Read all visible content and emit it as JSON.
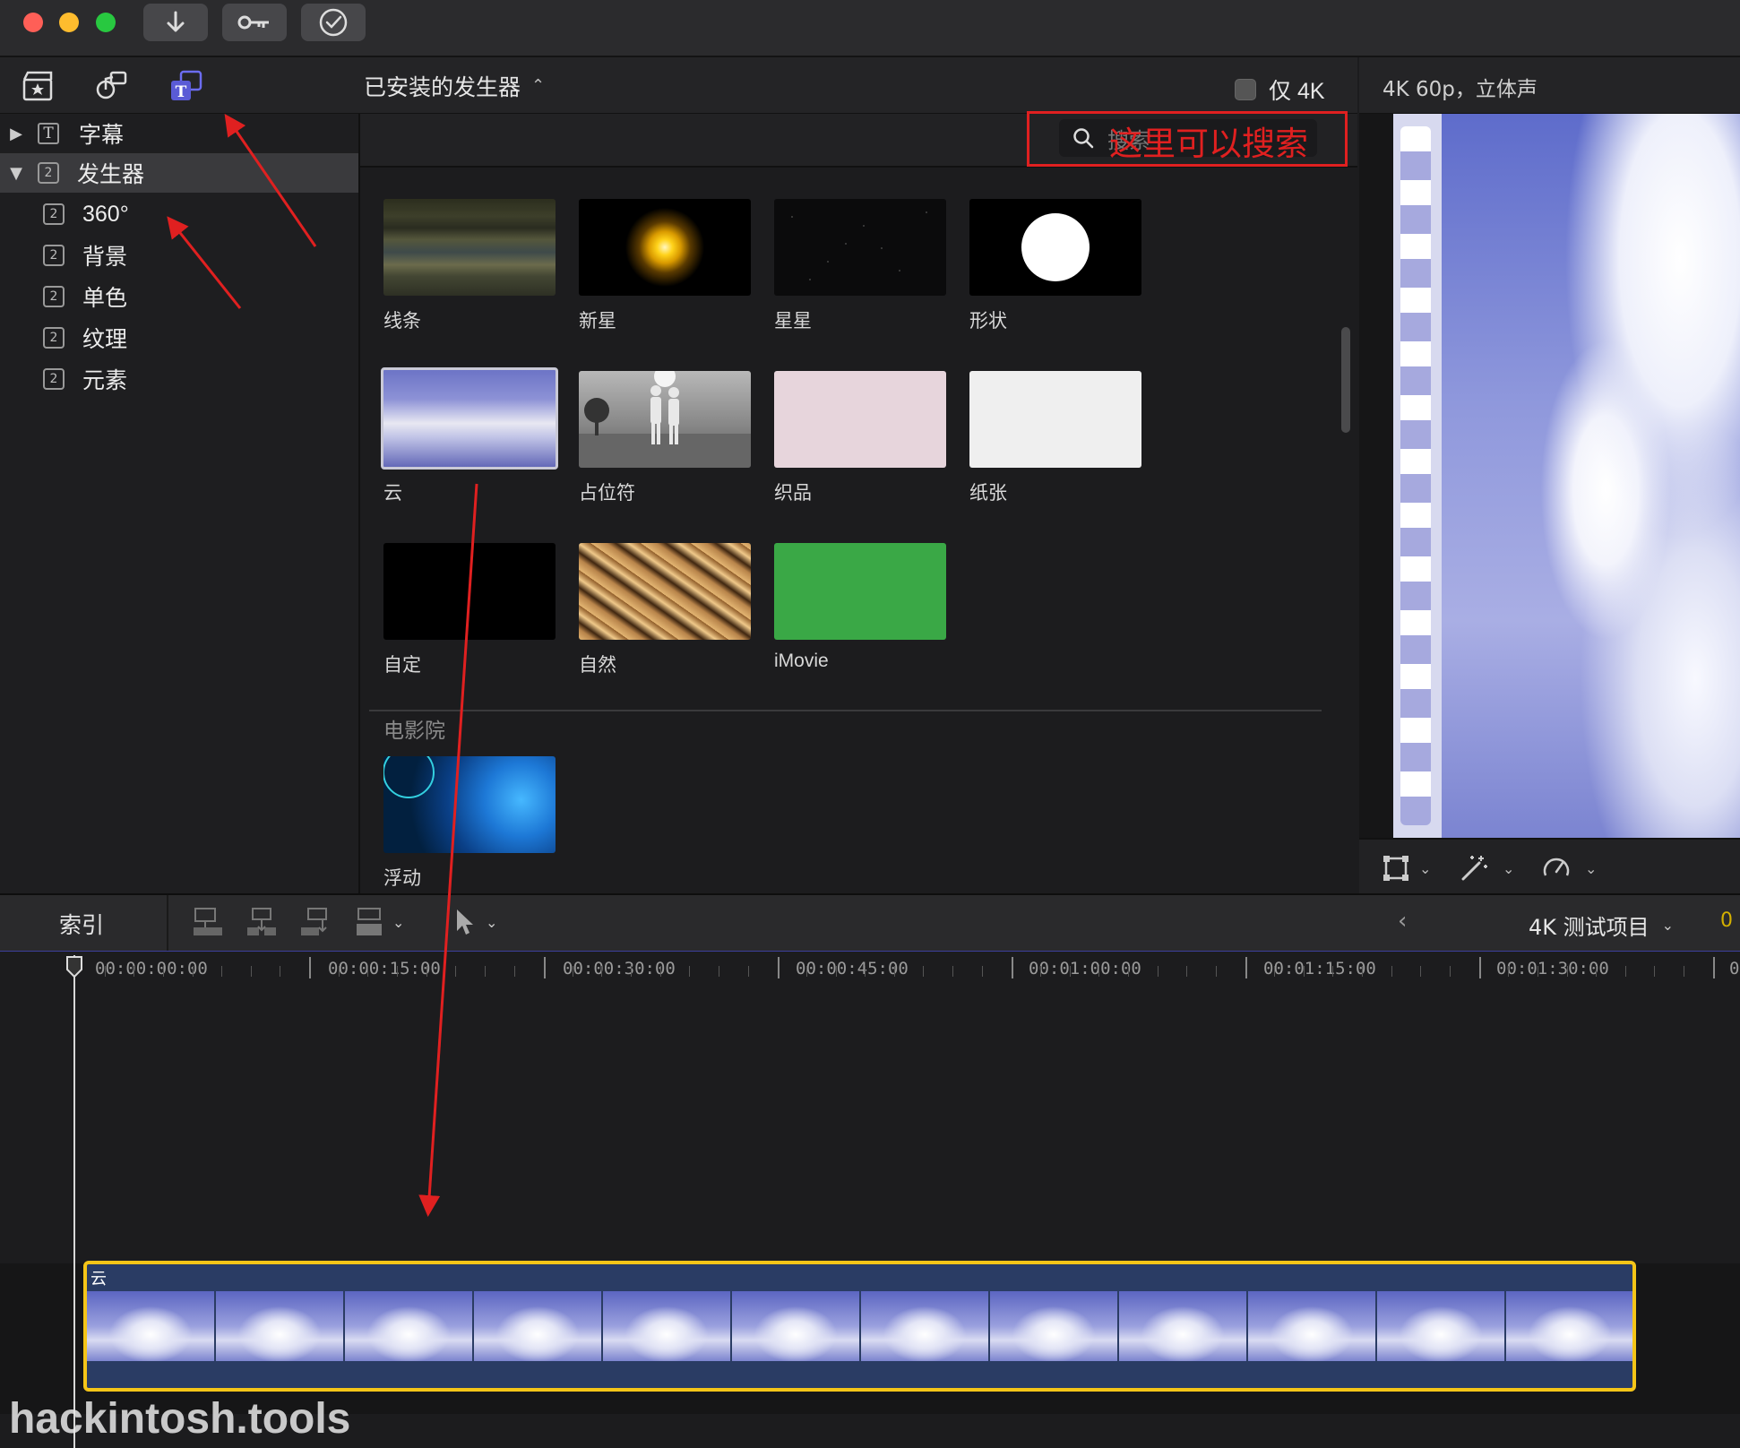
{
  "toolbar": {
    "buttons": [
      "import-arrow-icon",
      "key-icon",
      "checkmark-icon"
    ]
  },
  "browser": {
    "title": "已安装的发生器",
    "only_4k_label": "仅 4K",
    "only_4k_checked": false,
    "search_placeholder": "搜索",
    "search_annotation": "这里可以搜索"
  },
  "viewer": {
    "format_label": "4K 60p，立体声"
  },
  "sidebar": {
    "items": [
      {
        "label": "字幕",
        "expanded": false
      },
      {
        "label": "发生器",
        "expanded": true,
        "selected": true
      },
      {
        "label": "360°"
      },
      {
        "label": "背景"
      },
      {
        "label": "单色"
      },
      {
        "label": "纹理"
      },
      {
        "label": "元素"
      }
    ]
  },
  "generators": [
    {
      "label": "线条"
    },
    {
      "label": "新星"
    },
    {
      "label": "星星"
    },
    {
      "label": "形状"
    },
    {
      "label": "云",
      "selected": true
    },
    {
      "label": "占位符"
    },
    {
      "label": "织品"
    },
    {
      "label": "纸张"
    },
    {
      "label": "自定"
    },
    {
      "label": "自然"
    },
    {
      "label": "iMovie"
    }
  ],
  "cinema_section": {
    "header": "电影院",
    "items": [
      {
        "label": "浮动"
      }
    ]
  },
  "timeline": {
    "index_label": "索引",
    "project_name": "4K 测试项目",
    "timecode_partial": "0",
    "ruler": [
      "00:00:00:00",
      "00:00:15:00",
      "00:00:30:00",
      "00:00:45:00",
      "00:01:00:00",
      "00:01:15:00",
      "00:01:30:00",
      "0"
    ],
    "clip_label": "云"
  },
  "watermark": "hackintosh.tools",
  "colors": {
    "accent_purple": "#5a5bd6",
    "clip_border": "#f5c518",
    "annotation_red": "#e02020",
    "imovie_green": "#3aa846"
  }
}
